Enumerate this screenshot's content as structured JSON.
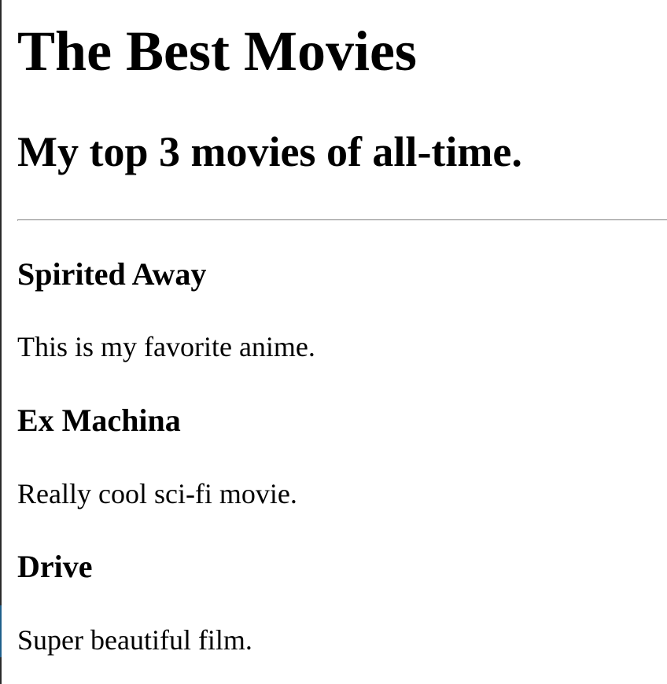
{
  "page": {
    "title": "The Best Movies",
    "subtitle": "My top 3 movies of all-time."
  },
  "movies": [
    {
      "title": "Spirited Away",
      "description": "This is my favorite anime."
    },
    {
      "title": "Ex Machina",
      "description": "Really cool sci-fi movie."
    },
    {
      "title": "Drive",
      "description": "Super beautiful film."
    }
  ],
  "colors": {
    "text": "#000000",
    "background": "#ffffff",
    "divider": "#9a9a9a",
    "window_edge": "#2b2b2b",
    "edge_accent": "#1f5f8b"
  }
}
